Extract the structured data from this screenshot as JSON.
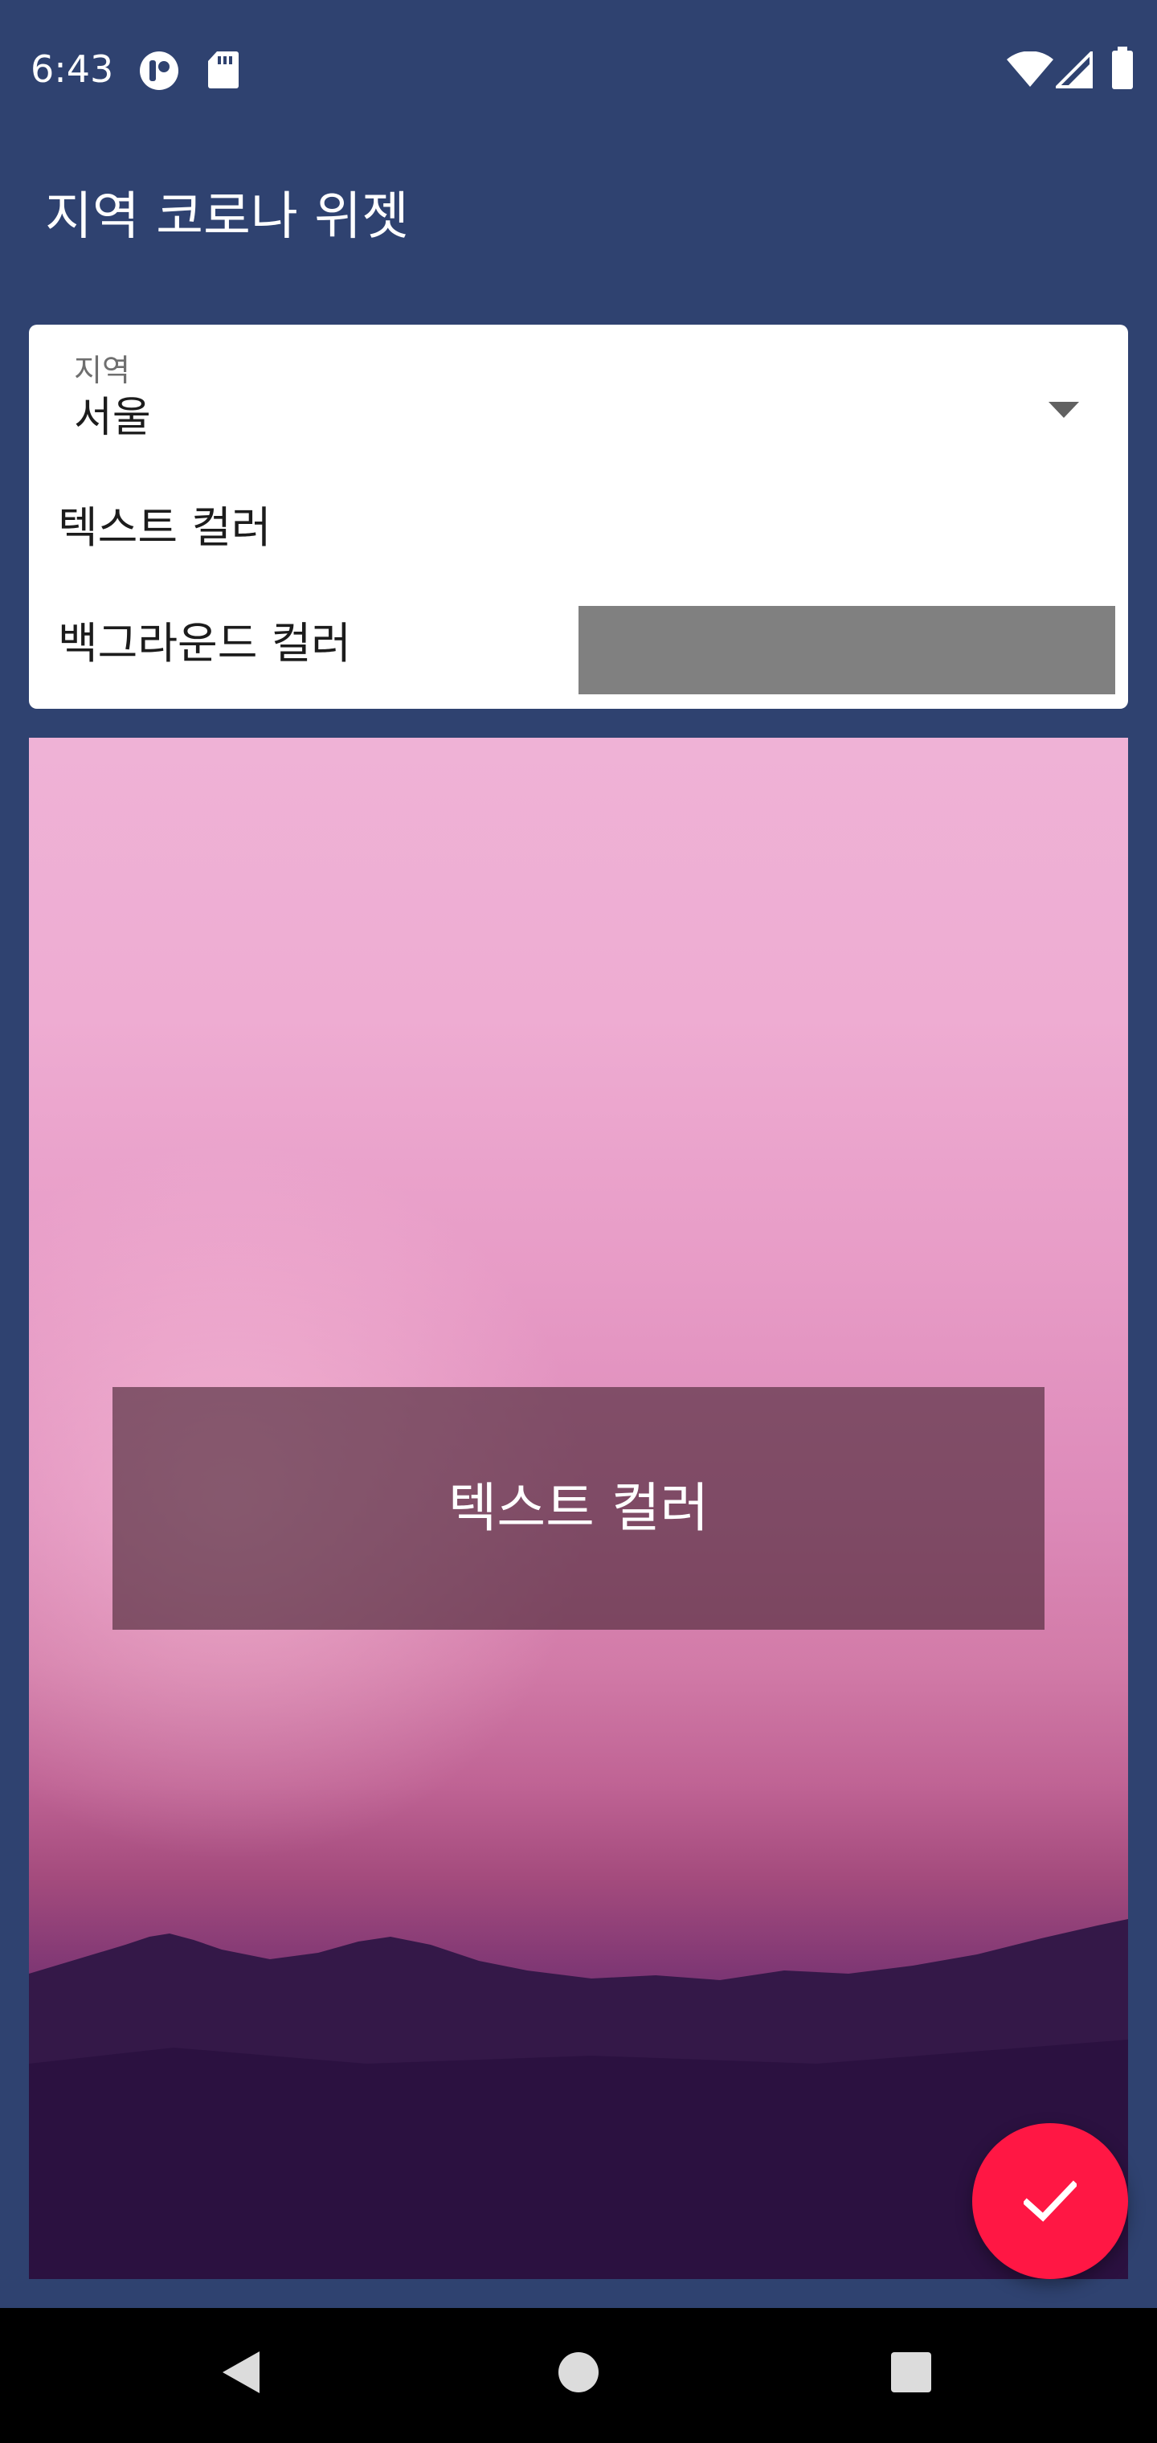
{
  "status_bar": {
    "time": "6:43",
    "left_icons": [
      "app-notification-icon",
      "sd-card-icon"
    ],
    "right_icons": [
      "wifi-icon",
      "cell-signal-icon",
      "battery-icon"
    ]
  },
  "app_bar": {
    "title": "지역 코로나 위젯"
  },
  "settings": {
    "region": {
      "label": "지역",
      "value": "서울",
      "icon": "dropdown-arrow-icon"
    },
    "text_color": {
      "label": "텍스트 컬러"
    },
    "background_color": {
      "label": "백그라운드 컬러",
      "swatch_color": "#808080"
    }
  },
  "preview": {
    "text": "텍스트 컬러",
    "box_color": "rgba(70,35,50,0.62)"
  },
  "fab": {
    "icon": "check-icon",
    "color": "#ff1744"
  },
  "nav_bar": {
    "icons": [
      "back-icon",
      "home-icon",
      "recents-icon"
    ]
  },
  "colors": {
    "primary": "#2f4270",
    "accent": "#ff1744"
  }
}
